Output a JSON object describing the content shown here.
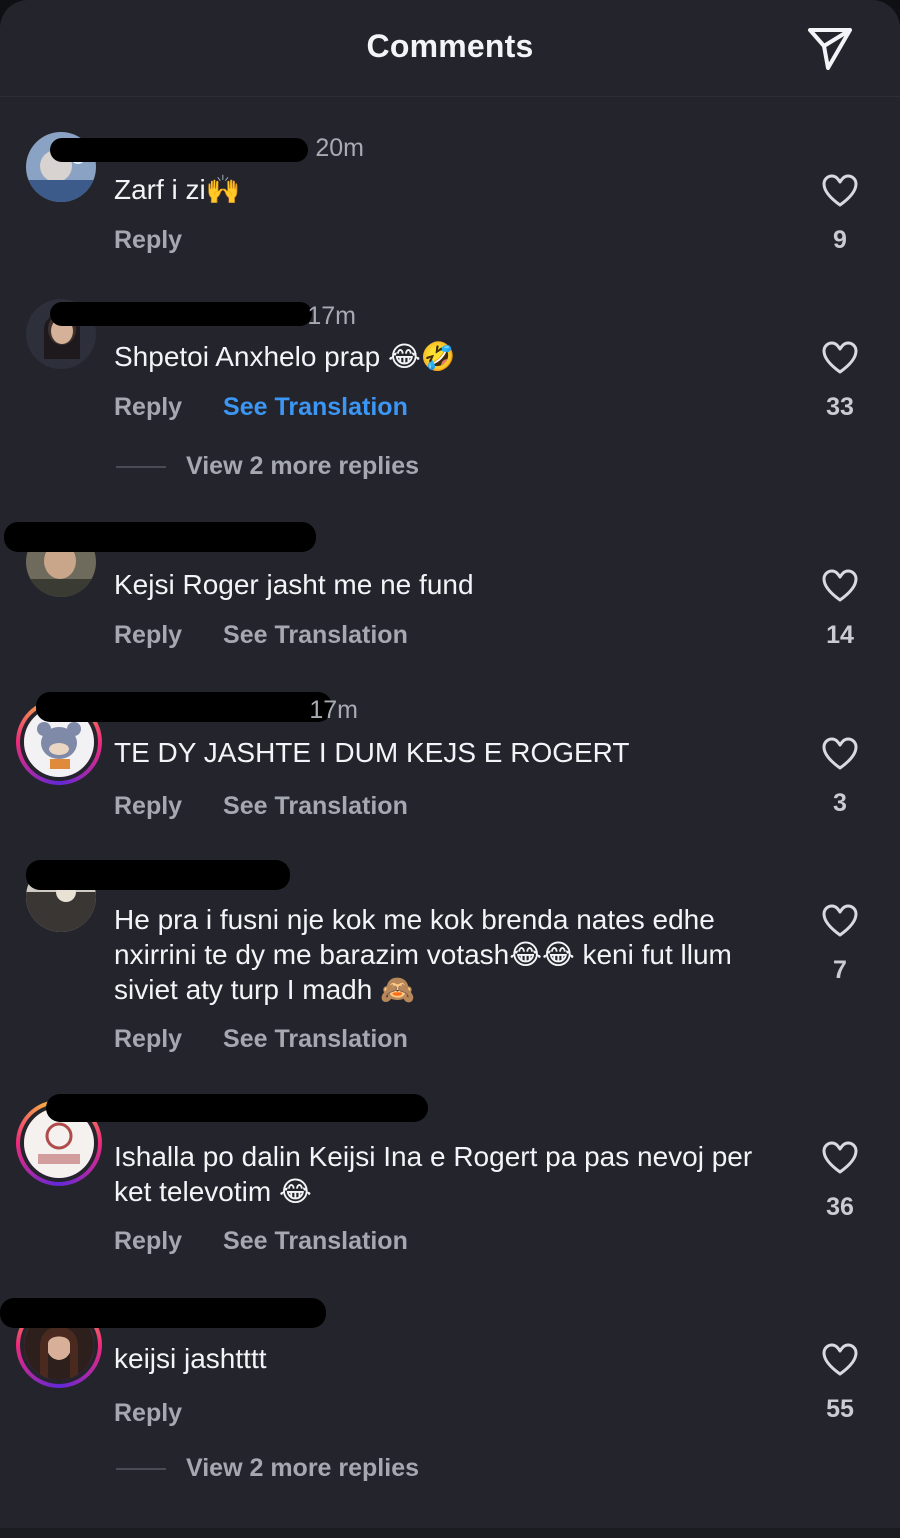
{
  "header": {
    "title": "Comments",
    "share_icon": "send-icon"
  },
  "comments": [
    {
      "time": "20m",
      "text": "Zarf i zi🙌",
      "reply_label": "Reply",
      "translation_label": "",
      "likes": "9",
      "more_replies": ""
    },
    {
      "time": "17m",
      "text": "Shpetoi Anxhelo prap 😂🤣",
      "reply_label": "Reply",
      "translation_label": "See Translation",
      "likes": "33",
      "more_replies": "View 2 more replies"
    },
    {
      "time": "",
      "text": "Kejsi Roger jasht me ne fund",
      "reply_label": "Reply",
      "translation_label": "See Translation",
      "likes": "14",
      "more_replies": ""
    },
    {
      "time": "17m",
      "text": "TE DY JASHTE I DUM KEJS E ROGERT",
      "reply_label": "Reply",
      "translation_label": "See Translation",
      "likes": "3",
      "more_replies": ""
    },
    {
      "time": "",
      "text": "He pra i fusni nje kok me kok brenda nates edhe nxirrini te dy me barazim votash😂😂 keni fut llum siviet aty turp I madh 🙈",
      "reply_label": "Reply",
      "translation_label": "See Translation",
      "likes": "7",
      "more_replies": ""
    },
    {
      "time": "",
      "text": "Ishalla po dalin Keijsi Ina e Rogert pa pas nevoj per ket televotim 😂",
      "reply_label": "Reply",
      "translation_label": "See Translation",
      "likes": "36",
      "more_replies": ""
    },
    {
      "time": "",
      "text": "keijsi jashtttt",
      "reply_label": "Reply",
      "translation_label": "",
      "likes": "55",
      "more_replies": "View 2 more replies"
    }
  ],
  "colors": {
    "background": "#24252c",
    "text": "#f3f4f7",
    "muted": "#a5a8b1",
    "link": "#3b96f5"
  }
}
